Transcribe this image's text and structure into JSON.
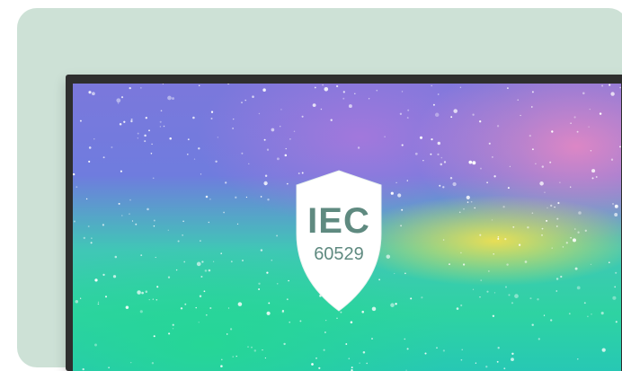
{
  "badge": {
    "line1": "IEC",
    "line2": "60529"
  },
  "colors": {
    "card_background": "#cde1d6",
    "frame": "#2e2e2e",
    "badge_fill": "#ffffff",
    "badge_text": "#5f8a80"
  },
  "icons": [
    "shield-icon"
  ]
}
